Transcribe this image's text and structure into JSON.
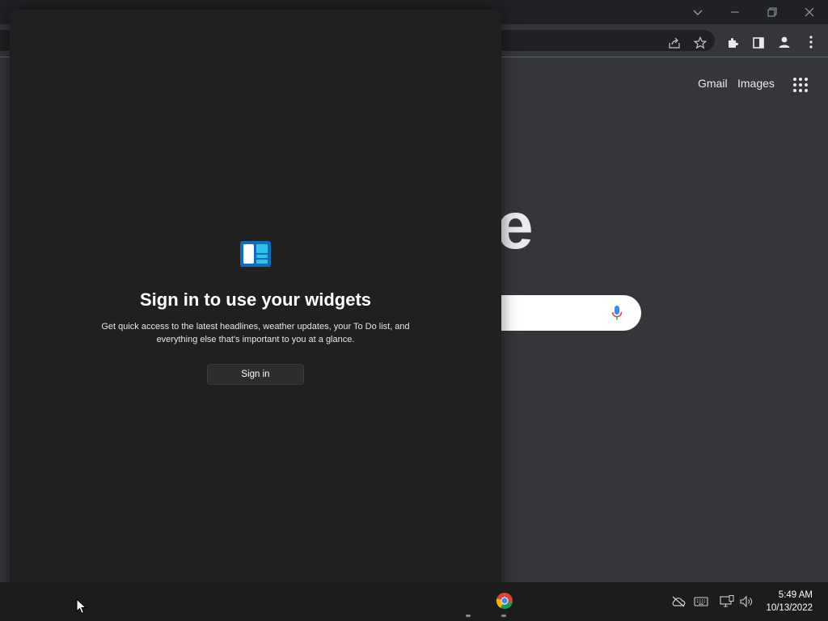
{
  "browser": {
    "toplinks": {
      "gmail": "Gmail",
      "images": "Images"
    },
    "logo_partial": "e",
    "icons": {
      "tab_search": "chevron-down-icon",
      "minimize": "minimize-icon",
      "restore": "restore-icon",
      "close": "close-icon",
      "share": "share-icon",
      "bookmark": "star-icon",
      "extensions": "puzzle-icon",
      "side_panel": "side-panel-icon",
      "profile": "profile-icon",
      "menu": "kebab-menu-icon",
      "apps": "apps-grid-icon",
      "voice": "microphone-icon"
    }
  },
  "widgets": {
    "title": "Sign in to use your widgets",
    "description": "Get quick access to the latest headlines, weather updates, your To Do list, and everything else that's important to you at a glance.",
    "signin_label": "Sign in",
    "logo_icon": "widgets-icon"
  },
  "taskbar": {
    "time": "5:49 AM",
    "date": "10/13/2022",
    "tray_icons": [
      "onedrive-offline-icon",
      "keyboard-icon",
      "network-icon",
      "volume-icon"
    ],
    "pinned": [
      "chrome-icon"
    ]
  },
  "colors": {
    "panel_bg": "#202020",
    "browser_bg": "#35363a",
    "taskbar_bg": "#1c1c1c",
    "widget_blue": "#0078d4"
  }
}
